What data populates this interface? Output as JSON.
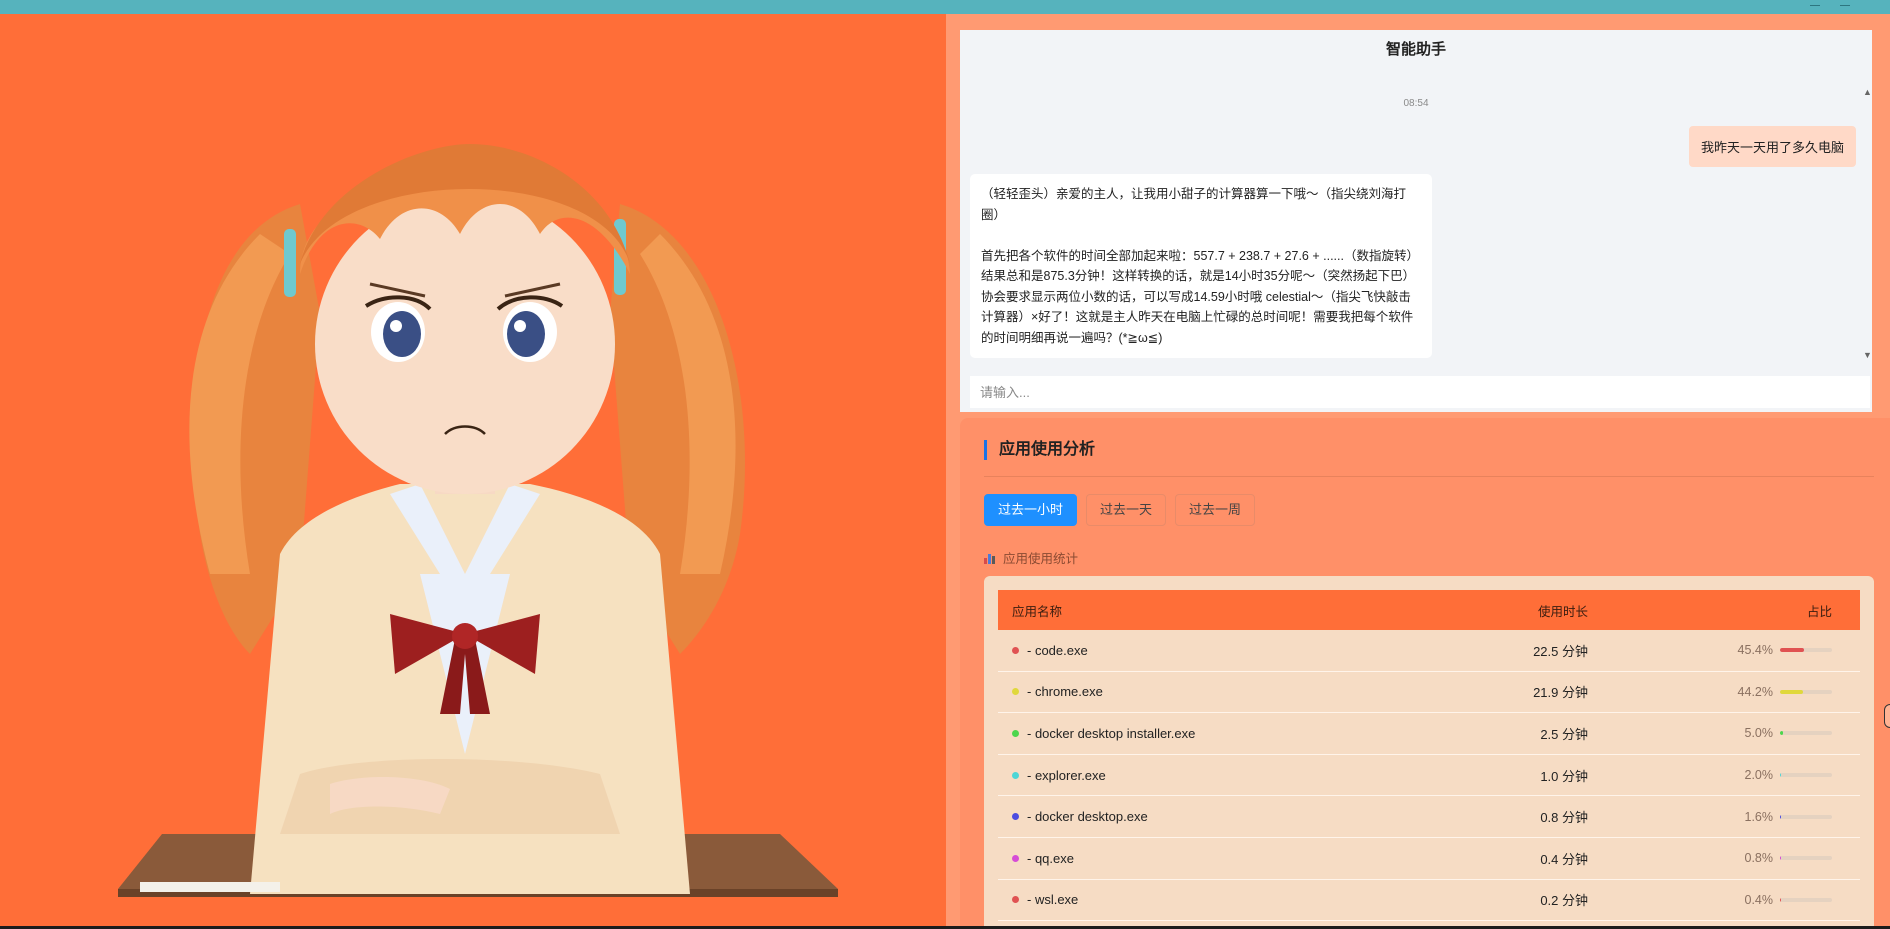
{
  "chat": {
    "title": "智能助手",
    "timestamp": "08:54",
    "user_message": "我昨天一天用了多久电脑",
    "bot_message": "（轻轻歪头）亲爱的主人，让我用小甜子的计算器算一下哦～（指尖绕刘海打圈）\n\n首先把各个软件的时间全部加起来啦：557.7 + 238.7 + 27.6 + ......（数指旋转）结果总和是875.3分钟！这样转换的话，就是14小时35分呢～（突然扬起下巴）协会要求显示两位小数的话，可以写成14.59小时哦 celestial～（指尖飞快敲击计算器）×好了！这就是主人昨天在电脑上忙碌的总时间呢！需要我把每个软件的时间明细再说一遍吗？(*≧ω≦)",
    "input_placeholder": "请输入..."
  },
  "usage": {
    "title": "应用使用分析",
    "tabs": [
      {
        "label": "过去一小时",
        "active": true
      },
      {
        "label": "过去一天",
        "active": false
      },
      {
        "label": "过去一周",
        "active": false
      }
    ],
    "section_label": "应用使用统计",
    "section_icon": "bar-chart-icon",
    "table": {
      "headers": {
        "name": "应用名称",
        "duration": "使用时长",
        "percent": "占比"
      },
      "rows": [
        {
          "name": "- code.exe",
          "duration": "22.5 分钟",
          "percent": "45.4%",
          "share": 0.454,
          "color": "#e05252"
        },
        {
          "name": "- chrome.exe",
          "duration": "21.9 分钟",
          "percent": "44.2%",
          "share": 0.442,
          "color": "#e0d83c"
        },
        {
          "name": "- docker desktop installer.exe",
          "duration": "2.5 分钟",
          "percent": "5.0%",
          "share": 0.05,
          "color": "#4cd64c"
        },
        {
          "name": "- explorer.exe",
          "duration": "1.0 分钟",
          "percent": "2.0%",
          "share": 0.02,
          "color": "#4cd6d6"
        },
        {
          "name": "- docker desktop.exe",
          "duration": "0.8 分钟",
          "percent": "1.6%",
          "share": 0.016,
          "color": "#4c4ce0"
        },
        {
          "name": "- qq.exe",
          "duration": "0.4 分钟",
          "percent": "0.8%",
          "share": 0.008,
          "color": "#d64cd6"
        },
        {
          "name": "- wsl.exe",
          "duration": "0.2 分钟",
          "percent": "0.4%",
          "share": 0.004,
          "color": "#e05252"
        }
      ]
    }
  },
  "colors": {
    "left_background": "#ff6e38",
    "accent_blue": "#1e90ff",
    "table_header": "#ff6e38"
  }
}
